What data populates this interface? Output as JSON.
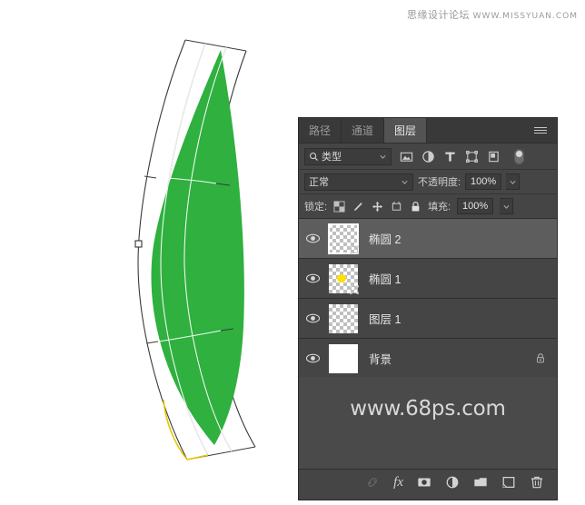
{
  "watermark_top": {
    "cn": "思缘设计论坛",
    "en": "WWW.MISSYUAN.COM"
  },
  "canvas": {
    "artwork_name": "warped-leaf-shape",
    "shape_fill": "#2fb03f",
    "grid_color": "#ffffff",
    "outline_color": "#3a3a3a",
    "selected_edge_color": "#e8c400",
    "anchor_handle": "left-middle-anchor"
  },
  "panel": {
    "title": "图层",
    "tabs": [
      {
        "label": "路径",
        "active": false
      },
      {
        "label": "通道",
        "active": false
      },
      {
        "label": "图层",
        "active": true
      }
    ],
    "menu_icon": "hamburger-menu-icon",
    "filter": {
      "search_icon": "search-icon",
      "kind_label": "类型",
      "icons": [
        "pixel-layer-filter-icon",
        "adjustment-layer-filter-icon",
        "type-layer-filter-icon",
        "shape-layer-filter-icon",
        "smart-object-filter-icon"
      ],
      "toggle": "filter-enable-toggle"
    },
    "blend": {
      "mode": "正常",
      "opacity_label": "不透明度:",
      "opacity_value": "100%"
    },
    "lock": {
      "label": "锁定:",
      "icons": [
        "lock-transparent-pixels-icon",
        "lock-image-pixels-icon",
        "lock-position-icon",
        "lock-artboard-nesting-icon",
        "lock-all-icon"
      ],
      "fill_label": "填充:",
      "fill_value": "100%"
    },
    "layers": [
      {
        "name": "椭圆 2",
        "visible": true,
        "selected": true,
        "thumb": "checker",
        "vector_mask": true,
        "locked": false
      },
      {
        "name": "椭圆 1",
        "visible": true,
        "selected": false,
        "thumb": "checker-yellow-ellipse",
        "vector_mask": true,
        "locked": false
      },
      {
        "name": "图层 1",
        "visible": true,
        "selected": false,
        "thumb": "checker",
        "vector_mask": false,
        "locked": false
      },
      {
        "name": "背景",
        "visible": true,
        "selected": false,
        "thumb": "white",
        "vector_mask": false,
        "locked": true
      }
    ],
    "watermark": "www.68ps.com",
    "footer_buttons": [
      "link-layers-icon",
      "layer-styles-fx-icon",
      "add-layer-mask-icon",
      "new-adjustment-layer-icon",
      "new-group-icon",
      "new-layer-icon",
      "delete-layer-icon"
    ],
    "fx_label": "fx"
  },
  "colors": {
    "panel_bg": "#454545",
    "panel_tab_bg": "#393939",
    "row_selected": "#5d5d5d",
    "text": "#e6e6e6",
    "green": "#2fb03f",
    "yellow": "#ffe000"
  }
}
